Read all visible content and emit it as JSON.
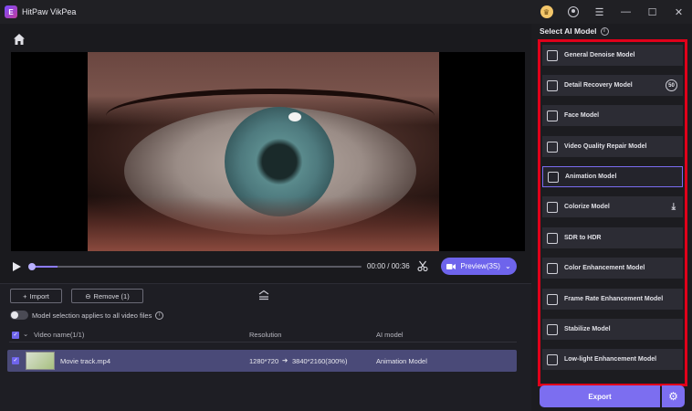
{
  "app": {
    "logo_letter": "E",
    "title": "HitPaw VikPea"
  },
  "window_controls": {
    "crown": "♛",
    "menu": "☰",
    "minimize": "—",
    "maximize": "☐",
    "close": "✕"
  },
  "player": {
    "time": "00:00 / 00:36",
    "preview_label": "Preview(3S)",
    "progress": 0.08
  },
  "files": {
    "import_label": "Import",
    "remove_label": "Remove (1)",
    "toggle_label": "Model selection applies to all video files",
    "columns": {
      "name": "Video name(1/1)",
      "resolution": "Resolution",
      "model": "AI model"
    },
    "rows": [
      {
        "name": "Movie track.mp4",
        "res_from": "1280*720",
        "res_to": "3840*2160(300%)",
        "model": "Animation Model"
      }
    ]
  },
  "ai_panel": {
    "title": "Select AI Model",
    "models": [
      {
        "label": "General Denoise Model",
        "icon": "denoise-icon"
      },
      {
        "label": "Detail Recovery Model",
        "icon": "detail-icon",
        "badge": "50"
      },
      {
        "label": "Face Model",
        "icon": "face-icon"
      },
      {
        "label": "Video Quality Repair Model",
        "icon": "repair-icon"
      },
      {
        "label": "Animation Model",
        "icon": "animation-icon",
        "active": true
      },
      {
        "label": "Colorize Model",
        "icon": "colorize-icon",
        "download": true
      },
      {
        "label": "SDR to HDR",
        "icon": "hdr-icon"
      },
      {
        "label": "Color Enhancement Model",
        "icon": "palette-icon"
      },
      {
        "label": "Frame Rate Enhancement Model",
        "icon": "frame-icon"
      },
      {
        "label": "Stabilize Model",
        "icon": "stabilize-icon"
      },
      {
        "label": "Low-light Enhancement Model",
        "icon": "lowlight-icon"
      }
    ],
    "export_label": "Export"
  },
  "colors": {
    "accent": "#7c6ef0",
    "highlight": "#e0001a",
    "row": "#4a4a78"
  }
}
